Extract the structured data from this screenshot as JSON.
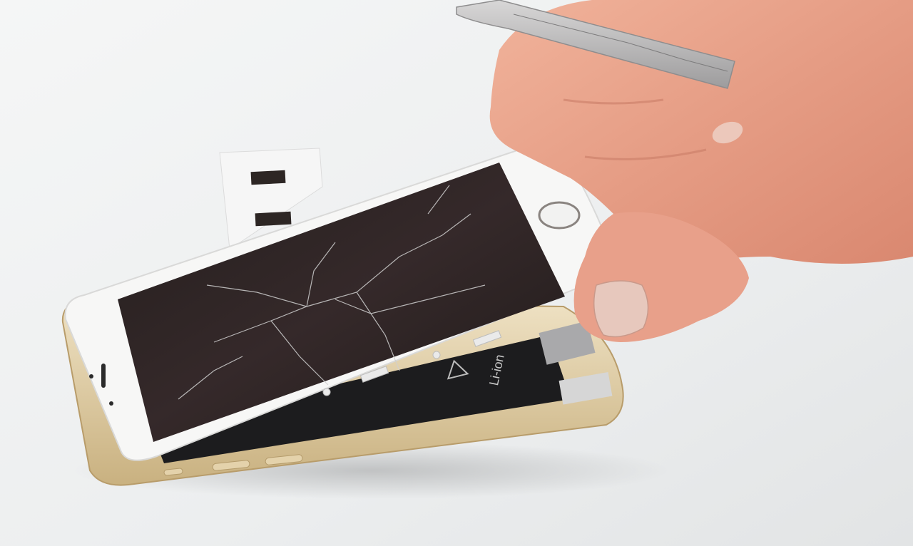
{
  "battery": {
    "label": "Li-ion"
  },
  "colors": {
    "background": "#f3f4f5",
    "phone_frame": "#d8c39a",
    "screen_glass": "#2a2322",
    "front_panel": "#f7f7f6",
    "battery": "#1c1c1e",
    "skin": "#e9a58d",
    "tape": "#f4f4f4",
    "tape_strip": "#2d2624",
    "spudger": "#b9b8b8"
  }
}
